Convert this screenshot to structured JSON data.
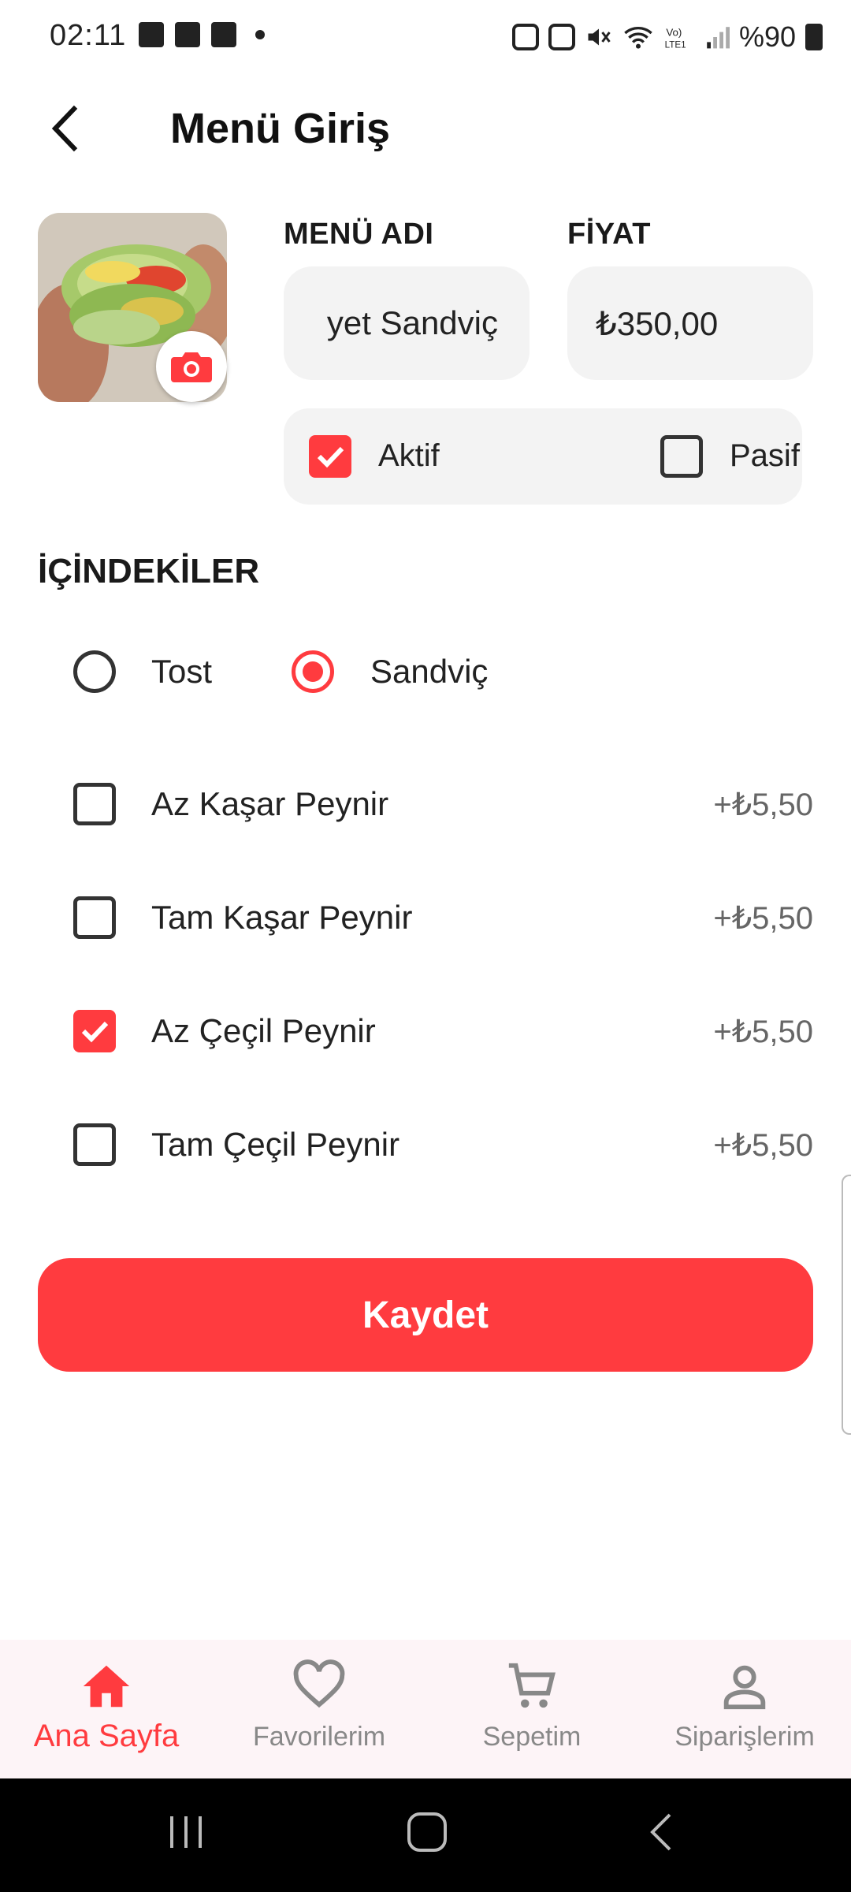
{
  "status_bar": {
    "time": "02:11",
    "battery": "%90"
  },
  "header": {
    "title": "Menü Giriş",
    "back_icon": "arrow-back-icon"
  },
  "form": {
    "name_label": "MENÜ ADI",
    "name_value": "yet Sandviç",
    "price_label": "FİYAT",
    "price_value": "₺350,00",
    "status": {
      "active_label": "Aktif",
      "active_checked": true,
      "passive_label": "Pasif",
      "passive_checked": false
    }
  },
  "ingredients": {
    "title": "İÇİNDEKİLER",
    "types": [
      {
        "label": "Tost",
        "selected": false
      },
      {
        "label": "Sandviç",
        "selected": true
      }
    ],
    "extras": [
      {
        "label": "Az Kaşar Peynir",
        "price": "+₺5,50",
        "checked": false
      },
      {
        "label": "Tam Kaşar Peynir",
        "price": "+₺5,50",
        "checked": false
      },
      {
        "label": "Az Çeçil Peynir",
        "price": "+₺5,50",
        "checked": true
      },
      {
        "label": "Tam Çeçil Peynir",
        "price": "+₺5,50",
        "checked": false
      }
    ]
  },
  "save_button": "Kaydet",
  "bottom_nav": [
    {
      "label": "Ana Sayfa",
      "icon": "home-icon",
      "active": true
    },
    {
      "label": "Favorilerim",
      "icon": "heart-icon",
      "active": false
    },
    {
      "label": "Sepetim",
      "icon": "cart-icon",
      "active": false
    },
    {
      "label": "Siparişlerim",
      "icon": "person-icon",
      "active": false
    }
  ],
  "colors": {
    "accent": "#ff3b3f",
    "field_bg": "#f3f3f3",
    "nav_bg": "#fdf4f7"
  }
}
